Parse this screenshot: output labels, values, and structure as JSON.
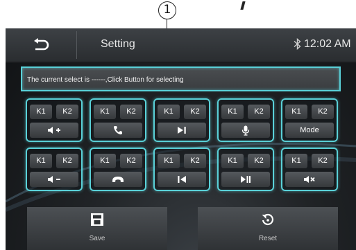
{
  "annotation": {
    "callout_number": "1"
  },
  "header": {
    "title": "Setting",
    "time": "12:02 AM"
  },
  "status": {
    "text": "The current select is ------,Click Button for selecting"
  },
  "keys": [
    {
      "k1": "K1",
      "k2": "K2",
      "icon": "volume-up-icon"
    },
    {
      "k1": "K1",
      "k2": "K2",
      "icon": "phone-answer-icon"
    },
    {
      "k1": "K1",
      "k2": "K2",
      "icon": "next-track-icon"
    },
    {
      "k1": "K1",
      "k2": "K2",
      "icon": "microphone-icon"
    },
    {
      "k1": "K1",
      "k2": "K2",
      "label": "Mode"
    },
    {
      "k1": "K1",
      "k2": "K2",
      "icon": "volume-down-icon"
    },
    {
      "k1": "K1",
      "k2": "K2",
      "icon": "phone-hangup-icon"
    },
    {
      "k1": "K1",
      "k2": "K2",
      "icon": "previous-track-icon"
    },
    {
      "k1": "K1",
      "k2": "K2",
      "icon": "play-pause-icon"
    },
    {
      "k1": "K1",
      "k2": "K2",
      "icon": "mute-icon"
    }
  ],
  "buttons": {
    "save_label": "Save",
    "reset_label": "Reset"
  },
  "colors": {
    "accent": "#5ad1d8",
    "background": "#1c1f22",
    "text": "#e8e8e8"
  }
}
